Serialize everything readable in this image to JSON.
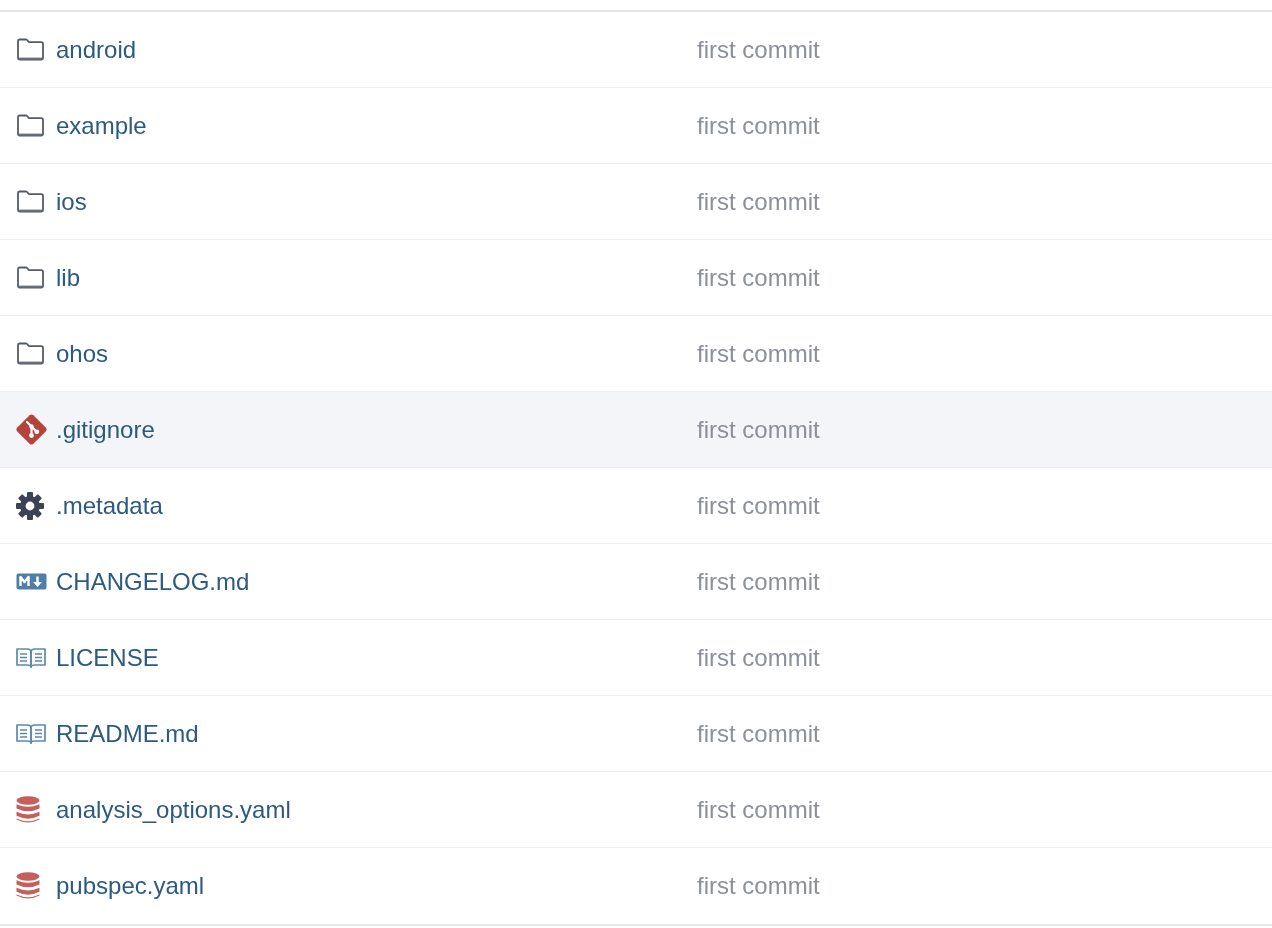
{
  "files": [
    {
      "name": "android",
      "kind": "folder",
      "commit_message": "first commit",
      "highlighted": false
    },
    {
      "name": "example",
      "kind": "folder",
      "commit_message": "first commit",
      "highlighted": false
    },
    {
      "name": "ios",
      "kind": "folder",
      "commit_message": "first commit",
      "highlighted": false
    },
    {
      "name": "lib",
      "kind": "folder",
      "commit_message": "first commit",
      "highlighted": false
    },
    {
      "name": "ohos",
      "kind": "folder",
      "commit_message": "first commit",
      "highlighted": false
    },
    {
      "name": ".gitignore",
      "kind": "git",
      "commit_message": "first commit",
      "highlighted": true
    },
    {
      "name": ".metadata",
      "kind": "config",
      "commit_message": "first commit",
      "highlighted": false
    },
    {
      "name": "CHANGELOG.md",
      "kind": "markdown",
      "commit_message": "first commit",
      "highlighted": false
    },
    {
      "name": "LICENSE",
      "kind": "book",
      "commit_message": "first commit",
      "highlighted": false
    },
    {
      "name": "README.md",
      "kind": "book",
      "commit_message": "first commit",
      "highlighted": false
    },
    {
      "name": "analysis_options.yaml",
      "kind": "data",
      "commit_message": "first commit",
      "highlighted": false
    },
    {
      "name": "pubspec.yaml",
      "kind": "data",
      "commit_message": "first commit",
      "highlighted": false
    }
  ]
}
